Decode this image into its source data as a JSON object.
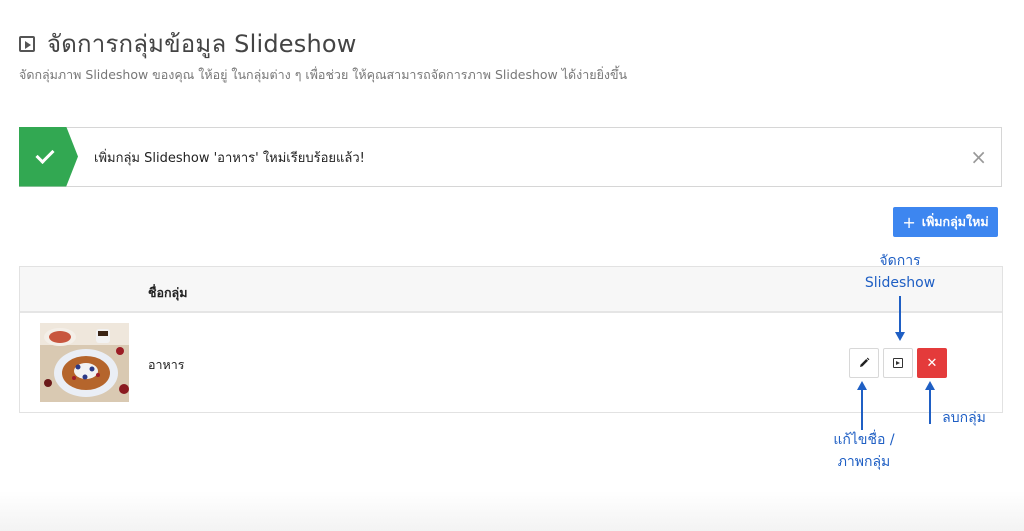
{
  "header": {
    "title": "จัดการกลุ่มข้อมูล Slideshow",
    "subtitle": "จัดกลุ่มภาพ Slideshow ของคุณ ให้อยู่ ในกลุ่มต่าง ๆ เพื่อช่วย ให้คุณสามารถจัดการภาพ Slideshow ได้ง่ายยิ่งขึ้น"
  },
  "alert": {
    "message": "เพิ่มกลุ่ม Slideshow 'อาหาร' ใหม่เรียบร้อยแล้ว!",
    "close_glyph": "×",
    "color": "#32a852"
  },
  "toolbar": {
    "add_label": "เพิ่มกลุ่มใหม่",
    "add_plus": "+",
    "color": "#3d86f0"
  },
  "table": {
    "columns": [
      "ชื่อกลุ่ม"
    ],
    "rows": [
      {
        "name": "อาหาร"
      }
    ]
  },
  "actions": {
    "delete_glyph": "✕",
    "delete_color": "#e43b3b"
  },
  "annotations": {
    "manage_line1": "จัดการ",
    "manage_line2": "Slideshow",
    "delete": "ลบกลุ่ม",
    "edit_line1": "แก้ไขชื่อ /",
    "edit_line2": "ภาพกลุ่ม",
    "color": "#1f5fc4"
  }
}
